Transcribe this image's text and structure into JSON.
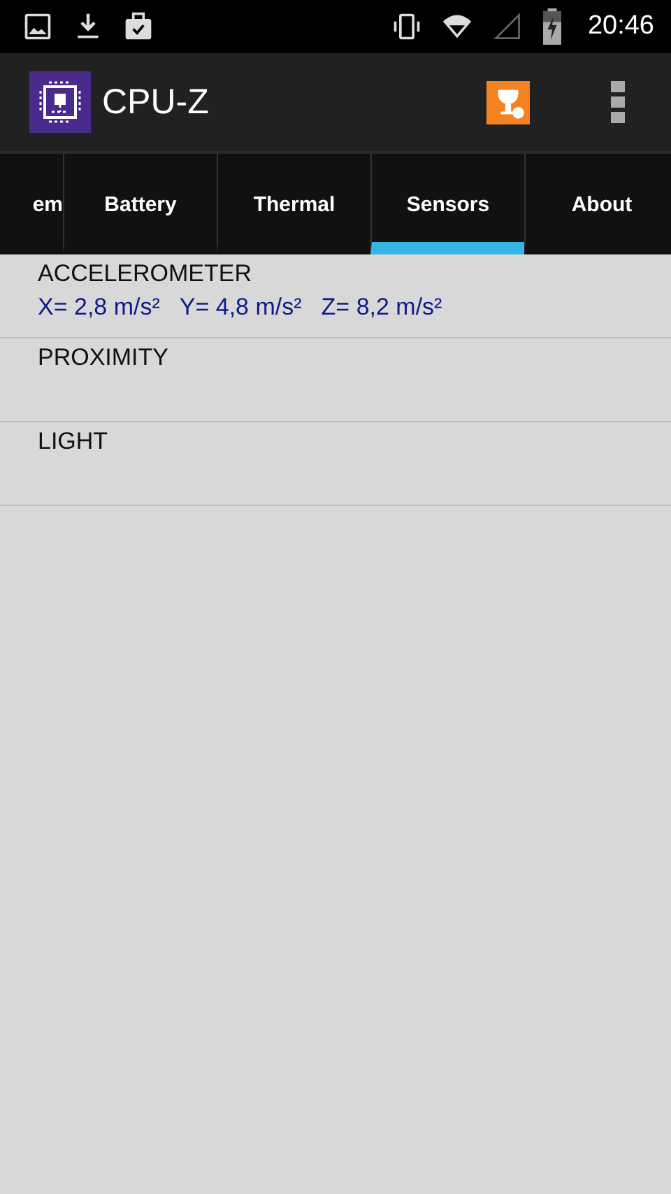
{
  "status_bar": {
    "time": "20:46"
  },
  "app_bar": {
    "title": "CPU-Z"
  },
  "tabs": [
    {
      "label": "em",
      "selected": false
    },
    {
      "label": "Battery",
      "selected": false
    },
    {
      "label": "Thermal",
      "selected": false
    },
    {
      "label": "Sensors",
      "selected": true
    },
    {
      "label": "About",
      "selected": false
    }
  ],
  "sensors": [
    {
      "name": "ACCELEROMETER",
      "values": [
        "X= 2,8 m/s²",
        "Y= 4,8 m/s²",
        "Z= 8,2 m/s²"
      ]
    },
    {
      "name": "PROXIMITY"
    },
    {
      "name": "LIGHT"
    }
  ]
}
